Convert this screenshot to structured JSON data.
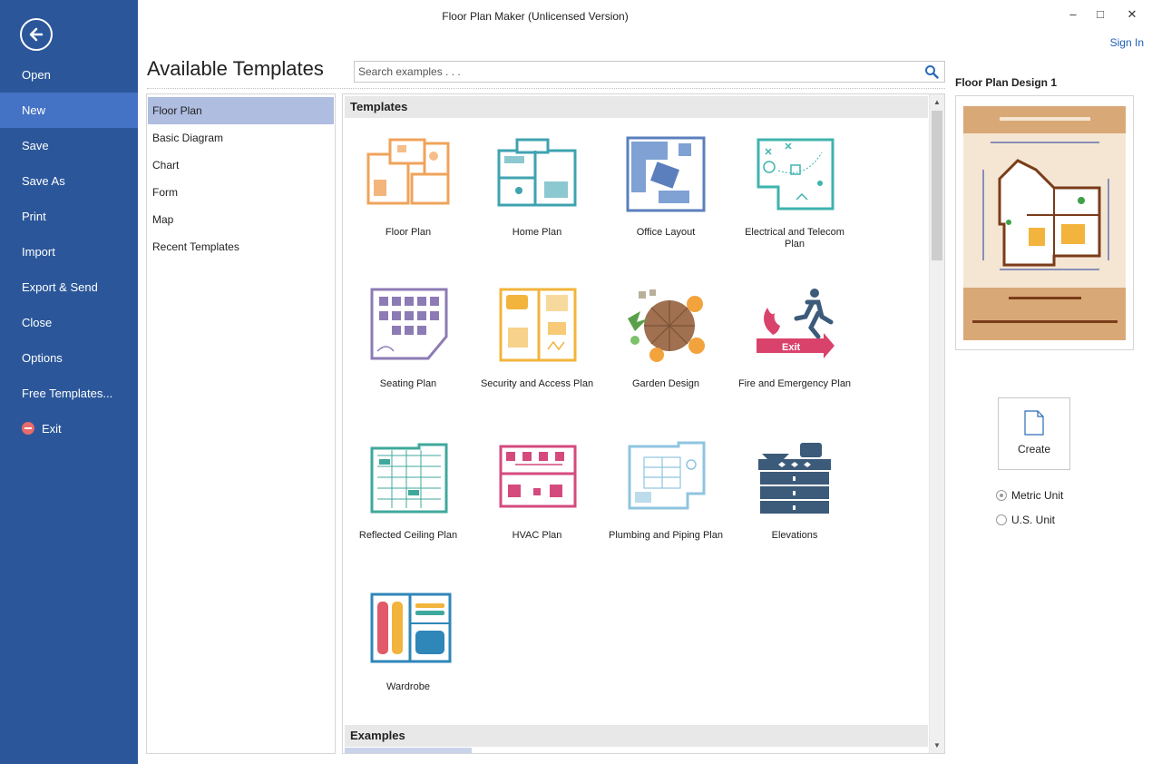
{
  "window": {
    "title": "Floor Plan Maker (Unlicensed Version)",
    "minimize": "–",
    "maximize": "□",
    "close": "✕",
    "sign_in": "Sign In"
  },
  "sidebar": {
    "items": [
      {
        "label": "Open"
      },
      {
        "label": "New"
      },
      {
        "label": "Save"
      },
      {
        "label": "Save As"
      },
      {
        "label": "Print"
      },
      {
        "label": "Import"
      },
      {
        "label": "Export & Send"
      },
      {
        "label": "Close"
      },
      {
        "label": "Options"
      },
      {
        "label": "Free Templates..."
      },
      {
        "label": "Exit"
      }
    ],
    "active": "New"
  },
  "heading": "Available Templates",
  "search": {
    "placeholder": "Search examples . . ."
  },
  "categories": {
    "items": [
      {
        "label": "Floor Plan"
      },
      {
        "label": "Basic Diagram"
      },
      {
        "label": "Chart"
      },
      {
        "label": "Form"
      },
      {
        "label": "Map"
      },
      {
        "label": "Recent Templates"
      }
    ],
    "active": "Floor Plan"
  },
  "templates_section": "Templates",
  "examples_section": "Examples",
  "templates": [
    {
      "label": "Floor Plan",
      "color": "#f0a35a"
    },
    {
      "label": "Home Plan",
      "color": "#3fa3b0"
    },
    {
      "label": "Office Layout",
      "color": "#5b7fbd"
    },
    {
      "label": "Electrical and Telecom Plan",
      "color": "#3fb3ad"
    },
    {
      "label": "Seating Plan",
      "color": "#8d7bb5"
    },
    {
      "label": "Security and Access Plan",
      "color": "#f2b43c"
    },
    {
      "label": "Garden Design",
      "color": "#a07050"
    },
    {
      "label": "Fire and Emergency Plan",
      "color": "#d9436b"
    },
    {
      "label": "Reflected Ceiling Plan",
      "color": "#3fa89c"
    },
    {
      "label": "HVAC Plan",
      "color": "#d44a7d"
    },
    {
      "label": "Plumbing and Piping Plan",
      "color": "#8fc4e0"
    },
    {
      "label": "Elevations",
      "color": "#3c5a7a"
    },
    {
      "label": "Wardrobe",
      "color": "#2f86b8"
    }
  ],
  "preview": {
    "title": "Floor Plan Design 1"
  },
  "create_label": "Create",
  "units": [
    {
      "label": "Metric Unit",
      "checked": true
    },
    {
      "label": "U.S. Unit",
      "checked": false
    }
  ]
}
